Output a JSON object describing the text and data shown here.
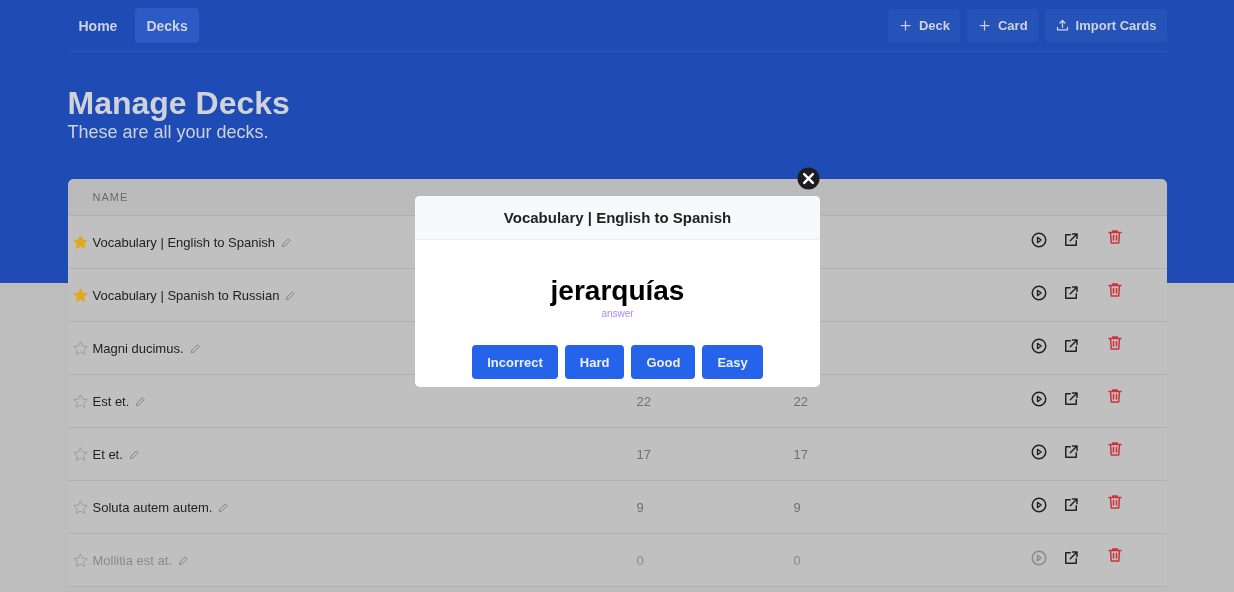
{
  "nav": {
    "links": [
      {
        "label": "Home",
        "selected": false
      },
      {
        "label": "Decks",
        "selected": true
      }
    ],
    "actions": [
      {
        "label": "Deck",
        "kind": "add"
      },
      {
        "label": "Card",
        "kind": "add"
      },
      {
        "label": "Import Cards",
        "kind": "import"
      }
    ]
  },
  "page": {
    "title": "Manage Decks",
    "subtitle": "These are all your decks."
  },
  "table": {
    "columns": [
      "NAME"
    ],
    "rows": [
      {
        "name": "Vocabulary | English to Spanish",
        "starred": true,
        "disabled": false
      },
      {
        "name": "Vocabulary | Spanish to Russian",
        "starred": true,
        "disabled": false
      },
      {
        "name": "Magni ducimus.",
        "starred": false,
        "disabled": false
      },
      {
        "name": "Est et.",
        "starred": false,
        "disabled": false,
        "cards": "22",
        "due": "22"
      },
      {
        "name": "Et et.",
        "starred": false,
        "disabled": false,
        "cards": "17",
        "due": "17"
      },
      {
        "name": "Soluta autem autem.",
        "starred": false,
        "disabled": false,
        "cards": "9",
        "due": "9"
      },
      {
        "name": "Mollitia est at.",
        "starred": false,
        "disabled": true,
        "cards": "0",
        "due": "0"
      }
    ]
  },
  "modal": {
    "deck_title": "Vocabulary | English to Spanish",
    "word": "jerarquías",
    "hint": "answer",
    "buttons": [
      "Incorrect",
      "Hard",
      "Good",
      "Easy"
    ]
  }
}
